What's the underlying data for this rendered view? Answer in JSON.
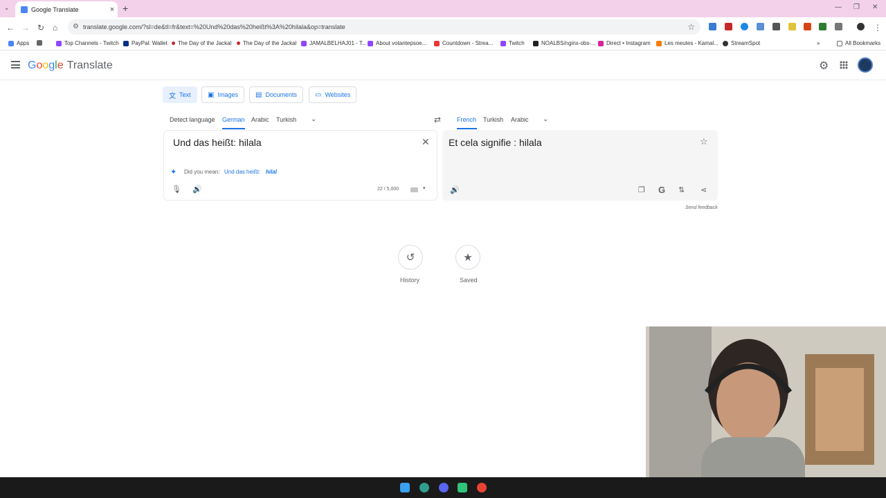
{
  "browser": {
    "tab_title": "Google Translate",
    "url": "translate.google.com/?sl=de&tl=fr&text=%20Und%20das%20heißt%3A%20hilala&op=translate",
    "bookmarks": [
      "Apps",
      "Top Channels - Twitch",
      "PayPal: Wallet",
      "The Day of the Jackal",
      "The Day of the Jackal",
      "JAMALBELHAJ01 - T...",
      "About votantepsoe...",
      "Countdown - Strea...",
      "Twitch",
      "NOALBS/nginx-obs-...",
      "Direct • Instagram",
      "Les meutes - Kamal...",
      "StreamSpot"
    ],
    "all_bookmarks": "All Bookmarks"
  },
  "header": {
    "logo_google": "Google",
    "logo_translate": "Translate"
  },
  "modes": [
    {
      "label": "Text",
      "icon": "translate-icon"
    },
    {
      "label": "Images",
      "icon": "image-icon"
    },
    {
      "label": "Documents",
      "icon": "document-icon"
    },
    {
      "label": "Websites",
      "icon": "website-icon"
    }
  ],
  "source_langs": [
    "Detect language",
    "German",
    "Arabic",
    "Turkish"
  ],
  "target_langs": [
    "French",
    "Turkish",
    "Arabic"
  ],
  "source": {
    "text": "Und das heißt: hilala",
    "did_you_mean_label": "Did you mean:",
    "did_you_mean_text": "Und das heißt:",
    "did_you_mean_em": "hilal",
    "char_count": "22 / 5,000"
  },
  "target": {
    "text": "Et cela signifie : hilala",
    "send_feedback": "Send feedback"
  },
  "bottom": {
    "history": "History",
    "saved": "Saved"
  },
  "colors": {
    "accent": "#1a73e8",
    "tabstrip": "#f3d1ea"
  }
}
